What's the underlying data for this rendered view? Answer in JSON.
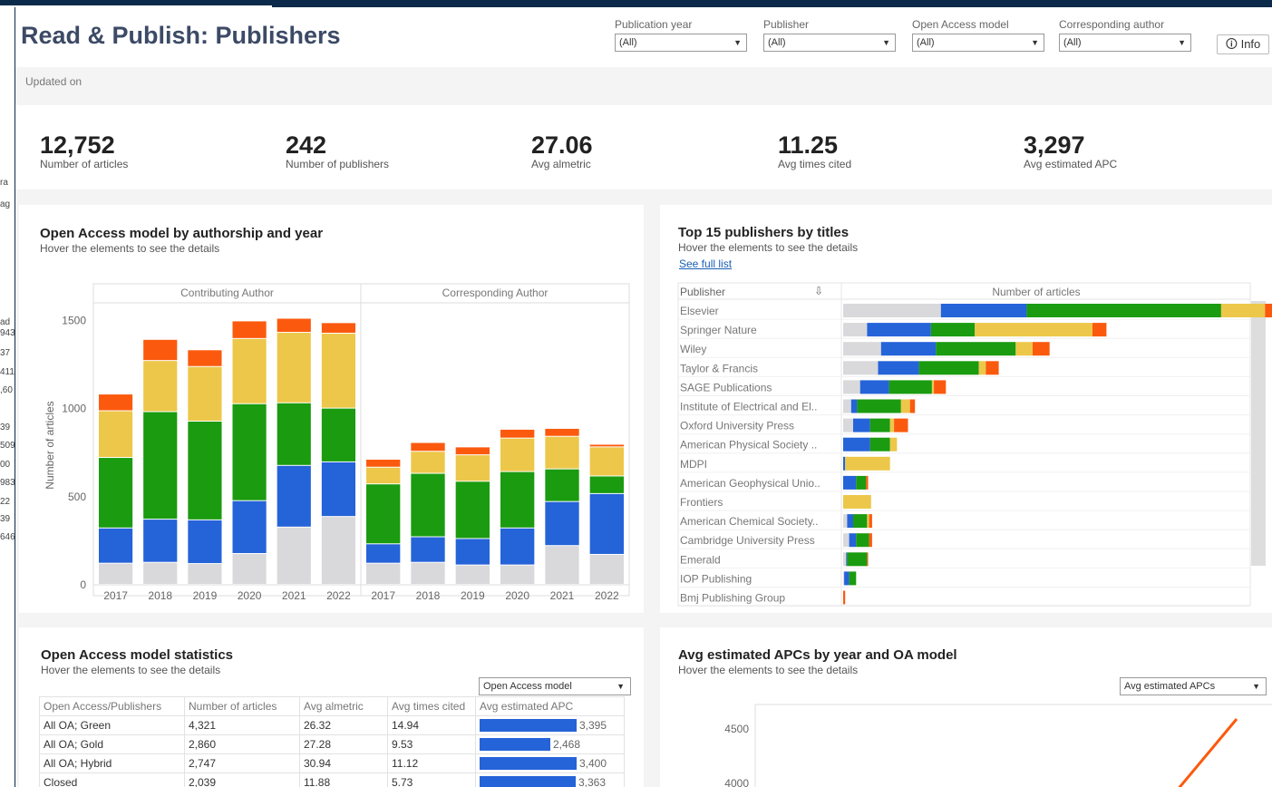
{
  "background_fragments": [
    "ag",
    "ad",
    "943",
    "37",
    "411",
    ",60",
    "39",
    "509",
    "00",
    "983",
    "22",
    "39",
    "646",
    "ra"
  ],
  "header": {
    "title": "Read & Publish: Publishers",
    "info_label": "Info",
    "filters": [
      {
        "label": "Publication year",
        "value": "(All)"
      },
      {
        "label": "Publisher",
        "value": "(All)"
      },
      {
        "label": "Open Access model",
        "value": "(All)"
      },
      {
        "label": "Corresponding author",
        "value": "(All)"
      }
    ],
    "updated_label": "Updated on"
  },
  "kpis": [
    {
      "value": "12,752",
      "label": "Number of articles"
    },
    {
      "value": "242",
      "label": "Number of publishers"
    },
    {
      "value": "27.06",
      "label": "Avg almetric"
    },
    {
      "value": "11.25",
      "label": "Avg times cited"
    },
    {
      "value": "3,297",
      "label": "Avg estimated APC"
    }
  ],
  "colors": {
    "closed": "#d9d9dc",
    "bronze": "#2563d8",
    "green": "#1a9b10",
    "gold": "#edc74a",
    "hybrid": "#fb5a0e"
  },
  "oa_card": {
    "title": "Open Access model by authorship and year",
    "subtitle": "Hover the elements to see the details"
  },
  "pub_card": {
    "title": "Top 15 publishers by titles",
    "subtitle": "Hover the elements to see the details",
    "link": "See full list",
    "col_publisher": "Publisher",
    "col_articles": "Number of articles"
  },
  "stats_card": {
    "title": "Open Access model statistics",
    "subtitle": "Hover the elements to see the details",
    "dropdown": "Open Access model",
    "headers": [
      "Open Access/Publishers",
      "Number of articles",
      "Avg almetric",
      "Avg times cited",
      "Avg estimated APC"
    ],
    "rows": [
      {
        "name": "All OA; Green",
        "articles": "4,321",
        "almetric": "26.32",
        "cited": "14.94",
        "apc": "3,395",
        "apc_value": 3395
      },
      {
        "name": "All OA; Gold",
        "articles": "2,860",
        "almetric": "27.28",
        "cited": "9.53",
        "apc": "2,468",
        "apc_value": 2468
      },
      {
        "name": "All OA; Hybrid",
        "articles": "2,747",
        "almetric": "30.94",
        "cited": "11.12",
        "apc": "3,400",
        "apc_value": 3400
      },
      {
        "name": "Closed",
        "articles": "2,039",
        "almetric": "11.88",
        "cited": "5.73",
        "apc": "3,363",
        "apc_value": 3363
      }
    ]
  },
  "apc_card": {
    "title": "Avg estimated APCs by year and OA model",
    "subtitle": "Hover the elements to see the details",
    "dropdown": "Avg estimated APCs"
  },
  "chart_data": [
    {
      "type": "bar",
      "stacked": true,
      "ylabel": "Number of articles",
      "ylim": [
        0,
        1600
      ],
      "yticks": [
        0,
        500,
        1000,
        1500
      ],
      "panels": [
        "Contributing Author",
        "Corresponding Author"
      ],
      "categories": [
        "2017",
        "2018",
        "2019",
        "2020",
        "2021",
        "2022"
      ],
      "series_colors": [
        "#d9d9dc",
        "#2563d8",
        "#1a9b10",
        "#edc74a",
        "#fb5a0e"
      ],
      "data": [
        [
          [
            120,
            200,
            400,
            265,
            95
          ],
          [
            125,
            245,
            610,
            290,
            120
          ],
          [
            118,
            248,
            560,
            310,
            95
          ],
          [
            175,
            300,
            550,
            370,
            100
          ],
          [
            325,
            350,
            355,
            400,
            80
          ],
          [
            385,
            310,
            305,
            425,
            60
          ]
        ],
        [
          [
            120,
            110,
            340,
            95,
            45
          ],
          [
            125,
            145,
            360,
            125,
            50
          ],
          [
            110,
            150,
            325,
            150,
            45
          ],
          [
            110,
            210,
            320,
            190,
            50
          ],
          [
            220,
            250,
            185,
            185,
            45
          ],
          [
            170,
            345,
            100,
            165,
            15
          ]
        ]
      ]
    },
    {
      "type": "bar",
      "orientation": "horizontal",
      "stacked": true,
      "categories": [
        "Elsevier",
        "Springer Nature",
        "Wiley",
        "Taylor & Francis",
        "SAGE Publications",
        "Institute of Electrical and El..",
        "Oxford University Press",
        "American Physical Society ..",
        "MDPI",
        "American Geophysical Unio..",
        "Frontiers",
        "American Chemical Society..",
        "Cambridge University Press",
        "Emerald",
        "IOP Publishing",
        "Bmj Publishing Group"
      ],
      "series_colors": [
        "#d9d9dc",
        "#2563d8",
        "#1a9b10",
        "#edc74a",
        "#fb5a0e"
      ],
      "data": [
        [
          98,
          86,
          195,
          44,
          19
        ],
        [
          24,
          64,
          44,
          118,
          14
        ],
        [
          38,
          55,
          80,
          17,
          17
        ],
        [
          35,
          41,
          60,
          7,
          13
        ],
        [
          17,
          29,
          43,
          2,
          12
        ],
        [
          8,
          6,
          44,
          9,
          5
        ],
        [
          10,
          17,
          20,
          4,
          14
        ],
        [
          0,
          27,
          20,
          7,
          0
        ],
        [
          0,
          2,
          0,
          45,
          0
        ],
        [
          0,
          13,
          10,
          0,
          2
        ],
        [
          0,
          0,
          0,
          28,
          0
        ],
        [
          4,
          6,
          14,
          2,
          3
        ],
        [
          6,
          7,
          13,
          0,
          3
        ],
        [
          3,
          1,
          20,
          0,
          1
        ],
        [
          1,
          5,
          7,
          0,
          0
        ],
        [
          0,
          0,
          0,
          0,
          2
        ]
      ]
    },
    {
      "type": "line",
      "yticks": [
        4000,
        4500
      ],
      "series": [
        {
          "color": "#fb5a0e"
        }
      ]
    }
  ]
}
